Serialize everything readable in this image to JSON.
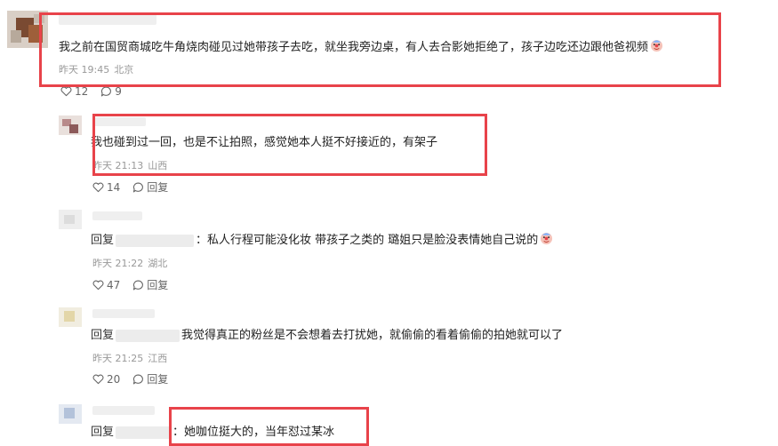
{
  "comments": [
    {
      "text": "我之前在国贸商城吃牛角烧肉碰见过她带孩子去吃，就坐我旁边桌，有人去合影她拒绝了，孩子边吃还边跟他爸视频",
      "time": "昨天 19:45",
      "location": "北京",
      "likes": "12",
      "replies_count": "9"
    }
  ],
  "replies": [
    {
      "text": "我也碰到过一回，也是不让拍照，感觉她本人挺不好接近的，有架子",
      "time": "昨天 21:13",
      "location": "山西",
      "likes": "14",
      "reply_label": "回复"
    },
    {
      "prefix": "回复",
      "text": "：私人行程可能没化妆 带孩子之类的 璐姐只是脸没表情她自己说的",
      "time": "昨天 21:22",
      "location": "湖北",
      "likes": "47",
      "reply_label": "回复"
    },
    {
      "prefix": "回复",
      "text": "我觉得真正的粉丝是不会想着去打扰她，就偷偷的看着偷偷的拍她就可以了",
      "time": "昨天 21:25",
      "location": "江西",
      "likes": "20",
      "reply_label": "回复"
    },
    {
      "prefix": "回复",
      "text": "：她咖位挺大的，当年怼过某冰"
    }
  ],
  "colors": {
    "highlight": "#e8434a",
    "meta": "#999999",
    "text": "#222222"
  },
  "icons": [
    "heart-icon",
    "comment-bubble-icon",
    "clown-emoji-icon"
  ]
}
